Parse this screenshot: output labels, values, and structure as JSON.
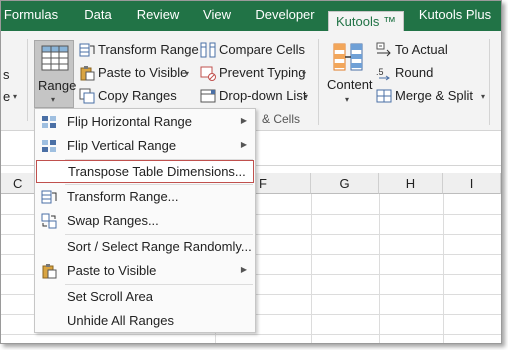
{
  "tabs": [
    "Formulas",
    "Data",
    "Review",
    "View",
    "Developer",
    "Kutools ™",
    "Kutools Plus"
  ],
  "ribbon": {
    "left_partial_top": "s",
    "left_partial_bottom": "e",
    "range_button": "Range",
    "transform_range": "Transform Range",
    "paste_to_visible": "Paste to Visible",
    "copy_ranges": "Copy Ranges",
    "compare_cells": "Compare Cells",
    "prevent_typing": "Prevent Typing",
    "dropdown_list": "Drop-down List",
    "group_label": "& Cells",
    "content": "Content",
    "to_actual": "To Actual",
    "round": "Round",
    "merge_split": "Merge & Split"
  },
  "columns": [
    "C",
    "F",
    "G",
    "H",
    "I"
  ],
  "menu": {
    "items": [
      {
        "label": "Flip Horizontal Range",
        "has_submenu": true,
        "icon": "flip-horizontal-icon"
      },
      {
        "label": "Flip Vertical Range",
        "has_submenu": true,
        "icon": "flip-vertical-icon"
      },
      {
        "label": "Transpose Table Dimensions...",
        "has_submenu": false,
        "icon": "",
        "highlighted": true
      },
      {
        "label": "Transform Range...",
        "has_submenu": false,
        "icon": "transform-range-icon"
      },
      {
        "label": "Swap Ranges...",
        "has_submenu": false,
        "icon": "swap-ranges-icon"
      },
      {
        "label": "Sort / Select Range Randomly...",
        "has_submenu": false,
        "icon": ""
      },
      {
        "label": "Paste to Visible",
        "has_submenu": true,
        "icon": "paste-icon"
      },
      {
        "label": "Set Scroll Area",
        "has_submenu": false,
        "icon": ""
      },
      {
        "label": "Unhide All Ranges",
        "has_submenu": false,
        "icon": ""
      }
    ]
  },
  "colors": {
    "tab_bar": "#217346",
    "highlight_border": "#c0504d"
  }
}
